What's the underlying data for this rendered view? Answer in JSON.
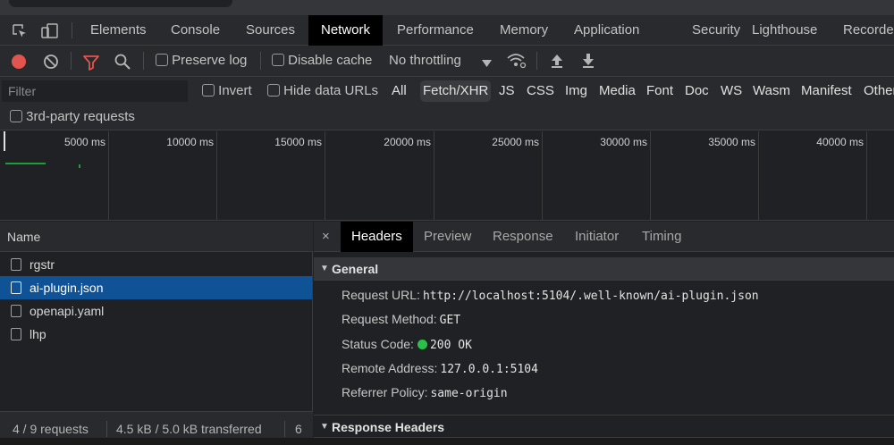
{
  "tabs": [
    "Elements",
    "Console",
    "Sources",
    "Network",
    "Performance",
    "Memory",
    "Application",
    "Security",
    "Lighthouse",
    "Recorder"
  ],
  "active_tab": "Network",
  "toolbar": {
    "preserve_log": "Preserve log",
    "disable_cache": "Disable cache",
    "throttling": "No throttling"
  },
  "filter": {
    "placeholder": "Filter",
    "invert": "Invert",
    "hide_data_urls": "Hide data URLs",
    "types": [
      "All",
      "Fetch/XHR",
      "JS",
      "CSS",
      "Img",
      "Media",
      "Font",
      "Doc",
      "WS",
      "Wasm",
      "Manifest",
      "Other"
    ],
    "active_type": "Fetch/XHR",
    "third_party": "3rd-party requests"
  },
  "timeline": {
    "labels": [
      "5000 ms",
      "10000 ms",
      "15000 ms",
      "20000 ms",
      "25000 ms",
      "30000 ms",
      "35000 ms",
      "40000 ms"
    ]
  },
  "requests": {
    "header": "Name",
    "rows": [
      "rgstr",
      "ai-plugin.json",
      "openapi.yaml",
      "lhp"
    ],
    "selected": "ai-plugin.json",
    "status": {
      "count": "4 / 9 requests",
      "transferred": "4.5 kB / 5.0 kB transferred",
      "resources": "6"
    }
  },
  "details": {
    "tabs": [
      "Headers",
      "Preview",
      "Response",
      "Initiator",
      "Timing"
    ],
    "active_tab": "Headers",
    "close": "×",
    "general_title": "General",
    "general": [
      {
        "key": "Request URL:",
        "value": "http://localhost:5104/.well-known/ai-plugin.json"
      },
      {
        "key": "Request Method:",
        "value": "GET"
      },
      {
        "key": "Status Code:",
        "value": "200 OK"
      },
      {
        "key": "Remote Address:",
        "value": "127.0.0.1:5104"
      },
      {
        "key": "Referrer Policy:",
        "value": "same-origin"
      }
    ],
    "response_headers_title": "Response Headers"
  },
  "colors": {
    "accent_selected": "#0f5396",
    "record": "#e4544e",
    "filter_active": "#e4544e",
    "status_ok": "#2ac04a"
  }
}
